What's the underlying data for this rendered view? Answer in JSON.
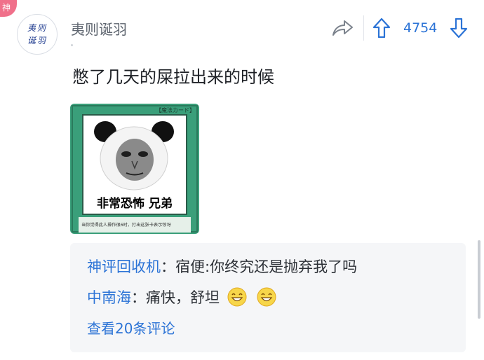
{
  "badge": "神",
  "avatar_text": "夷则诞羽",
  "username": "夷则诞羽",
  "vote_count": "4754",
  "post_text": "憋了几天的屎拉出来的时候",
  "meme": {
    "card_header": "【魔法カード】",
    "caption": "非常恐怖 兄弟",
    "footer": "当你觉得此人操作很6时，打出这张卡表示惊讶"
  },
  "comments": [
    {
      "author": "神评回收机",
      "sep": "：",
      "text": "宿便:你终究还是抛弃我了吗",
      "emojis": []
    },
    {
      "author": "中南海",
      "sep": "：",
      "text": "痛快，舒坦",
      "emojis": [
        "grin-emoji",
        "grin-emoji"
      ]
    }
  ],
  "view_all": "查看20条评论",
  "colors": {
    "accent": "#2b73d6",
    "card_green": "#3a9f7a",
    "badge": "#f0708a"
  },
  "icons": [
    "share-icon",
    "upvote-icon",
    "downvote-icon"
  ]
}
